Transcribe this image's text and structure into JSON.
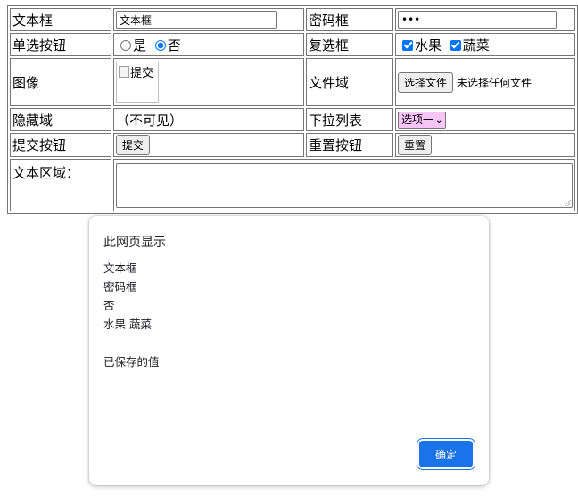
{
  "form": {
    "rows": {
      "text": {
        "label": "文本框",
        "value": "文本框",
        "label2": "密码框",
        "password_value": "•••"
      },
      "radio": {
        "label": "单选按钮",
        "yes": "是",
        "no": "否",
        "label2": "复选框",
        "fruit": "水果",
        "veg": "蔬菜"
      },
      "image": {
        "label": "图像",
        "alt": "提交",
        "label2": "文件域",
        "file_button": "选择文件",
        "file_status": "未选择任何文件"
      },
      "hidden": {
        "label": "隐藏域",
        "note": "（不可见）",
        "label2": "下拉列表",
        "select_value": "选项一"
      },
      "buttons": {
        "label": "提交按钮",
        "submit": "提交",
        "label2": "重置按钮",
        "reset": "重置"
      },
      "textarea": {
        "label": "文本区域："
      }
    }
  },
  "dialog": {
    "title": "此网页显示",
    "lines": [
      "文本框",
      "密码框",
      "否",
      "水果 蔬菜",
      "",
      "已保存的值"
    ],
    "ok_label": "确定"
  },
  "colors": {
    "accent": "#1a73e8",
    "select_bg": "#f7c6f7"
  }
}
